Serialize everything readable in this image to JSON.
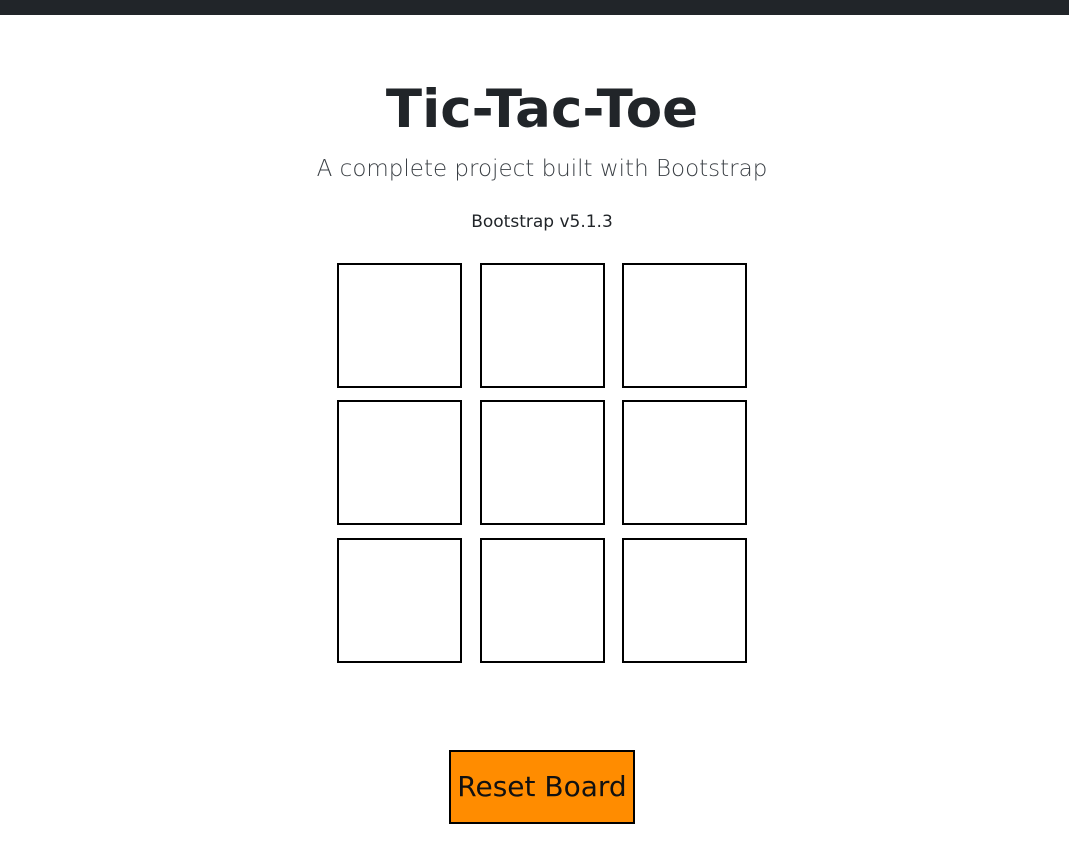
{
  "page": {
    "title": "Tic-Tac-Toe",
    "subtitle": "A complete project built with Bootstrap",
    "version": "Bootstrap v5.1.3"
  },
  "board": {
    "cells": [
      "",
      "",
      "",
      "",
      "",
      "",
      "",
      "",
      ""
    ]
  },
  "controls": {
    "reset_label": "Reset Board",
    "reset_color": "#ff8c00"
  },
  "colors": {
    "top_bar": "#212529",
    "text": "#212529",
    "cell_border": "#000000"
  }
}
